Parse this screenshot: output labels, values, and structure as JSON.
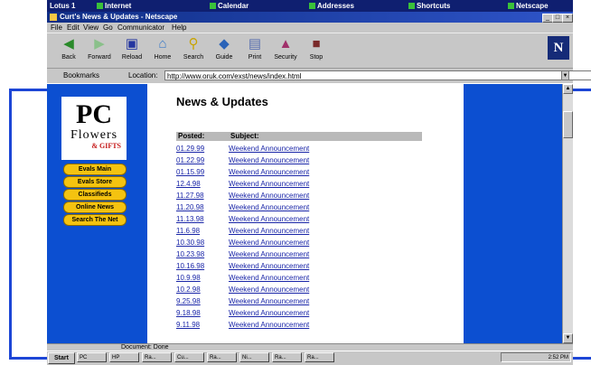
{
  "topstrip": {
    "items": [
      "Lotus 1",
      "Internet",
      "Calendar",
      "Addresses",
      "Shortcuts",
      "Netscape"
    ]
  },
  "window": {
    "title": "Curt's News & Updates - Netscape",
    "minimize": "_",
    "maximize": "□",
    "close": "×"
  },
  "menu": [
    "File",
    "Edit",
    "View",
    "Go",
    "Communicator",
    "Help"
  ],
  "toolbar": {
    "buttons": [
      {
        "label": "Back",
        "icon": "back-arrow-icon"
      },
      {
        "label": "Forward",
        "icon": "forward-arrow-icon"
      },
      {
        "label": "Reload",
        "icon": "reload-icon"
      },
      {
        "label": "Home",
        "icon": "home-icon"
      },
      {
        "label": "Search",
        "icon": "search-icon"
      },
      {
        "label": "Guide",
        "icon": "guide-icon"
      },
      {
        "label": "Print",
        "icon": "print-icon"
      },
      {
        "label": "Security",
        "icon": "security-icon"
      },
      {
        "label": "Stop",
        "icon": "stop-icon"
      }
    ],
    "brand": "N"
  },
  "location": {
    "bookmarks_label": "Bookmarks",
    "location_label": "Location:",
    "url": "http://www.oruk.com/exst/news/index.html"
  },
  "logo": {
    "pc": "PC",
    "flowers": "Flowers",
    "gifts": "& GIFTS"
  },
  "nav": [
    "Evals Main",
    "Evals Store",
    "Classifieds",
    "Online News",
    "Search The Net"
  ],
  "page": {
    "heading": "News & Updates",
    "col_posted": "Posted:",
    "col_subject": "Subject:",
    "rows": [
      {
        "date": "01.29.99",
        "subject": "Weekend Announcement"
      },
      {
        "date": "01.22.99",
        "subject": "Weekend Announcement"
      },
      {
        "date": "01.15.99",
        "subject": "Weekend Announcement"
      },
      {
        "date": "12.4.98",
        "subject": "Weekend Announcement"
      },
      {
        "date": "11.27.98",
        "subject": "Weekend Announcement"
      },
      {
        "date": "11.20.98",
        "subject": "Weekend Announcement"
      },
      {
        "date": "11.13.98",
        "subject": "Weekend Announcement"
      },
      {
        "date": "11.6.98",
        "subject": "Weekend Announcement"
      },
      {
        "date": "10.30.98",
        "subject": "Weekend Announcement"
      },
      {
        "date": "10.23.98",
        "subject": "Weekend Announcement"
      },
      {
        "date": "10.16.98",
        "subject": "Weekend Announcement"
      },
      {
        "date": "10.9.98",
        "subject": "Weekend Announcement"
      },
      {
        "date": "10.2.98",
        "subject": "Weekend Announcement"
      },
      {
        "date": "9.25.98",
        "subject": "Weekend Announcement"
      },
      {
        "date": "9.18.98",
        "subject": "Weekend Announcement"
      },
      {
        "date": "9.11.98",
        "subject": "Weekend Announcement"
      }
    ]
  },
  "status": {
    "text": "Document: Done"
  },
  "taskbar": {
    "start": "Start",
    "tasks": [
      "PC",
      "HP",
      "Ra...",
      "Cu...",
      "Ra...",
      "Ni...",
      "Ra...",
      "Ra..."
    ],
    "clock": "2:52 PM"
  },
  "colors": {
    "frame": "#1d46d6",
    "page_bg": "#0c4fd1",
    "nav_button": "#f4c310",
    "link": "#1a26a8"
  }
}
